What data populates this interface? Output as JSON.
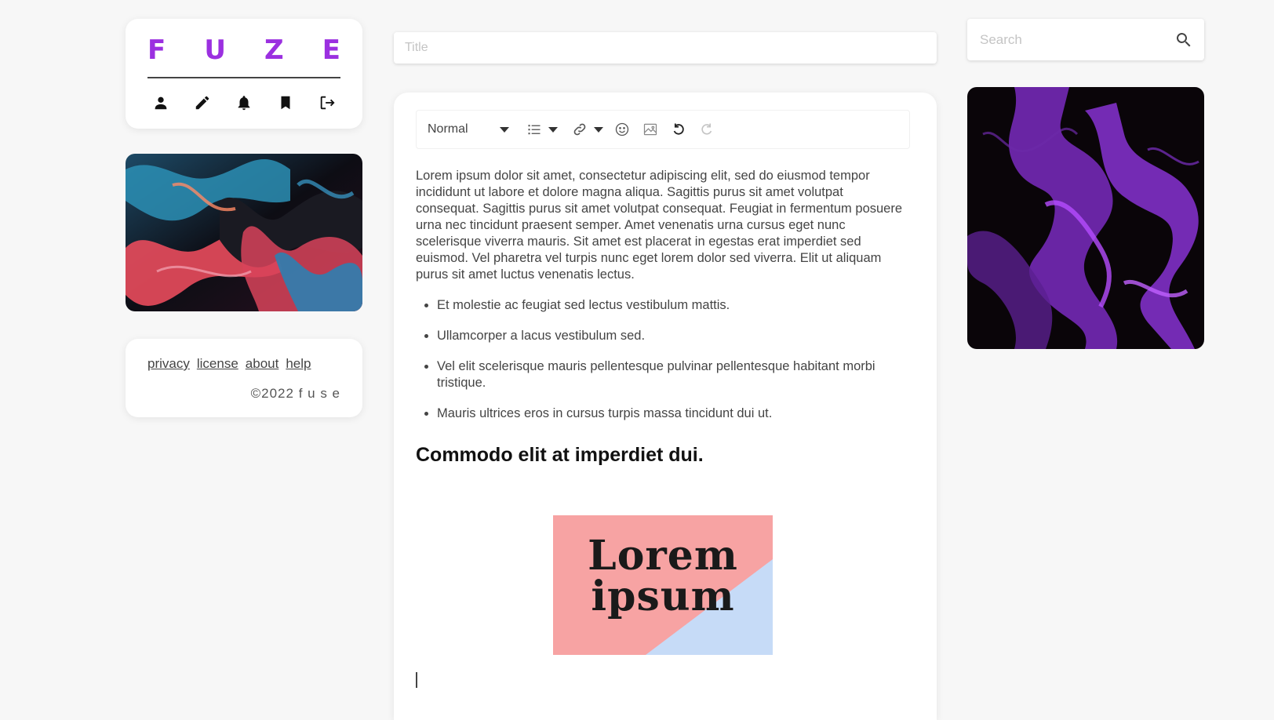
{
  "brand": {
    "letters": [
      "F",
      "U",
      "Z",
      "E"
    ],
    "color": "#9b30e0"
  },
  "nav": [
    {
      "icon": "person-icon",
      "label": "profile"
    },
    {
      "icon": "pencil-icon",
      "label": "write"
    },
    {
      "icon": "bell-icon",
      "label": "notifications"
    },
    {
      "icon": "bookmark-icon",
      "label": "bookmarks"
    },
    {
      "icon": "logout-icon",
      "label": "log out"
    }
  ],
  "footer": {
    "links": [
      "privacy",
      "license",
      "about",
      "help"
    ],
    "copyright": "©2022 f u s e"
  },
  "title_field": {
    "placeholder": "Title",
    "value": ""
  },
  "toolbar": {
    "format_select": "Normal",
    "buttons": [
      "list-icon",
      "link-icon",
      "emoji-icon",
      "image-icon",
      "undo-icon",
      "redo-icon"
    ]
  },
  "document": {
    "paragraph": "Lorem ipsum dolor sit amet, consectetur adipiscing elit, sed do eiusmod tempor incididunt ut labore et dolore magna aliqua. Sagittis purus sit amet volutpat consequat. Sagittis purus sit amet volutpat consequat. Feugiat in fermentum posuere urna nec tincidunt praesent semper. Amet venenatis urna cursus eget nunc scelerisque viverra mauris. Sit amet est placerat in egestas erat imperdiet sed euismod. Vel pharetra vel turpis nunc eget lorem dolor sed viverra. Elit ut aliquam purus sit amet luctus venenatis lectus.",
    "bullets": [
      "Et molestie ac feugiat sed lectus vestibulum mattis.",
      "Ullamcorper a lacus vestibulum sed.",
      "Vel elit scelerisque mauris pellentesque pulvinar pellentesque habitant morbi tristique.",
      "Mauris ultrices eros in cursus turpis massa tincidunt dui ut."
    ],
    "heading": "Commodo elit at imperdiet dui.",
    "image_text": [
      "Lorem",
      "ipsum"
    ],
    "image_colors": {
      "pink": "#f7a3a3",
      "blue": "#c6dbf7"
    }
  },
  "search": {
    "placeholder": "Search",
    "value": ""
  },
  "colors": {
    "background": "#f7f7f7",
    "card": "#ffffff",
    "accent": "#9b30e0"
  }
}
